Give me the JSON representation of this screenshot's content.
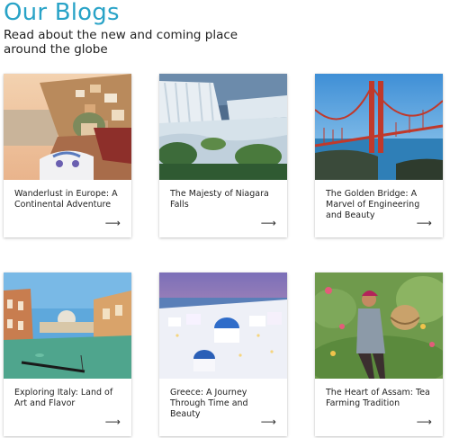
{
  "header": {
    "title": "Our Blogs",
    "subtitle": "Read about the new and coming place around the globe"
  },
  "colors": {
    "accent": "#29a3c7"
  },
  "cards": [
    {
      "title": "Wanderlust in Europe: A Continental Adventure",
      "arrow": "⟶",
      "icon": "arrow-right-icon"
    },
    {
      "title": "The Majesty of Niagara Falls",
      "arrow": "⟶",
      "icon": "arrow-right-icon"
    },
    {
      "title": "The Golden Bridge: A Marvel of Engineering and Beauty",
      "arrow": "⟶",
      "icon": "arrow-right-icon"
    },
    {
      "title": "Exploring Italy: Land of Art and Flavor",
      "arrow": "⟶",
      "icon": "arrow-right-icon"
    },
    {
      "title": "Greece: A Journey Through Time and Beauty",
      "arrow": "⟶",
      "icon": "arrow-right-icon"
    },
    {
      "title": "The Heart of Assam: Tea Farming Tradition",
      "arrow": "⟶",
      "icon": "arrow-right-icon"
    }
  ]
}
